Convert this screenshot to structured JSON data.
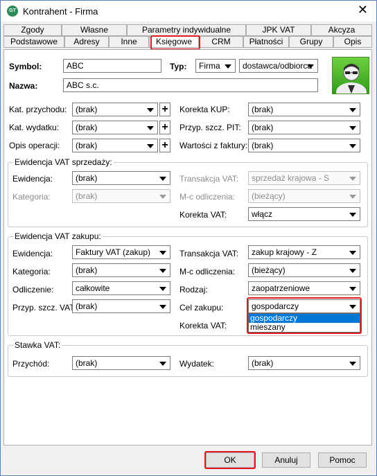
{
  "window": {
    "title": "Kontrahent - Firma"
  },
  "tabs_row1": [
    "Zgody",
    "Własne",
    "Parametry indywidualne",
    "JPK VAT",
    "Akcyza"
  ],
  "tabs_row2": [
    "Podstawowe",
    "Adresy",
    "Inne",
    "Księgowe",
    "CRM",
    "Płatności",
    "Grupy",
    "Opis"
  ],
  "active_tab": "Księgowe",
  "header": {
    "symbol_label": "Symbol:",
    "symbol_value": "ABC",
    "typ_label": "Typ:",
    "typ_value": "Firma",
    "typ2_value": "dostawca/odbiorca",
    "nazwa_label": "Nazwa:",
    "nazwa_value": "ABC s.c."
  },
  "general": {
    "kat_przychodu_label": "Kat. przychodu:",
    "kat_przychodu_value": "(brak)",
    "kat_wydatku_label": "Kat. wydatku:",
    "kat_wydatku_value": "(brak)",
    "opis_operacji_label": "Opis operacji:",
    "opis_operacji_value": "(brak)",
    "korekta_kup_label": "Korekta KUP:",
    "korekta_kup_value": "(brak)",
    "przyp_szcz_pit_label": "Przyp. szcz. PIT:",
    "przyp_szcz_pit_value": "(brak)",
    "wartosci_label": "Wartości z faktury:",
    "wartosci_value": "(brak)",
    "plus_symbol": "+"
  },
  "sprzedaz": {
    "title": "Ewidencja VAT sprzedaży:",
    "ewidencja_label": "Ewidencja:",
    "ewidencja_value": "(brak)",
    "kategoria_label": "Kategoria:",
    "kategoria_value": "(brak)",
    "transakcja_label": "Transakcja VAT:",
    "transakcja_value": "sprzedaż krajowa - S",
    "mc_label": "M-c odliczenia:",
    "mc_value": "(bieżący)",
    "korekta_label": "Korekta VAT:",
    "korekta_value": "włącz"
  },
  "zakup": {
    "title": "Ewidencja VAT zakupu:",
    "ewidencja_label": "Ewidencja:",
    "ewidencja_value": "Faktury VAT (zakup)",
    "kategoria_label": "Kategoria:",
    "kategoria_value": "(brak)",
    "odliczenie_label": "Odliczenie:",
    "odliczenie_value": "całkowite",
    "przyp_label": "Przyp. szcz. VAT:",
    "przyp_value": "(brak)",
    "transakcja_label": "Transakcja VAT:",
    "transakcja_value": "zakup krajowy - Z",
    "mc_label": "M-c odliczenia:",
    "mc_value": "(bieżący)",
    "rodzaj_label": "Rodzaj:",
    "rodzaj_value": "zaopatrzeniowe",
    "cel_label": "Cel zakupu:",
    "cel_value": "gospodarczy",
    "cel_options": [
      "gospodarczy",
      "mieszany"
    ],
    "korekta_label": "Korekta VAT:"
  },
  "stawka": {
    "title": "Stawka VAT:",
    "przychod_label": "Przychód:",
    "przychod_value": "(brak)",
    "wydatek_label": "Wydatek:",
    "wydatek_value": "(brak)"
  },
  "buttons": {
    "ok": "OK",
    "anuluj": "Anuluj",
    "pomoc": "Pomoc"
  },
  "colors": {
    "highlight": "#e0191e",
    "selection": "#0078d7"
  }
}
